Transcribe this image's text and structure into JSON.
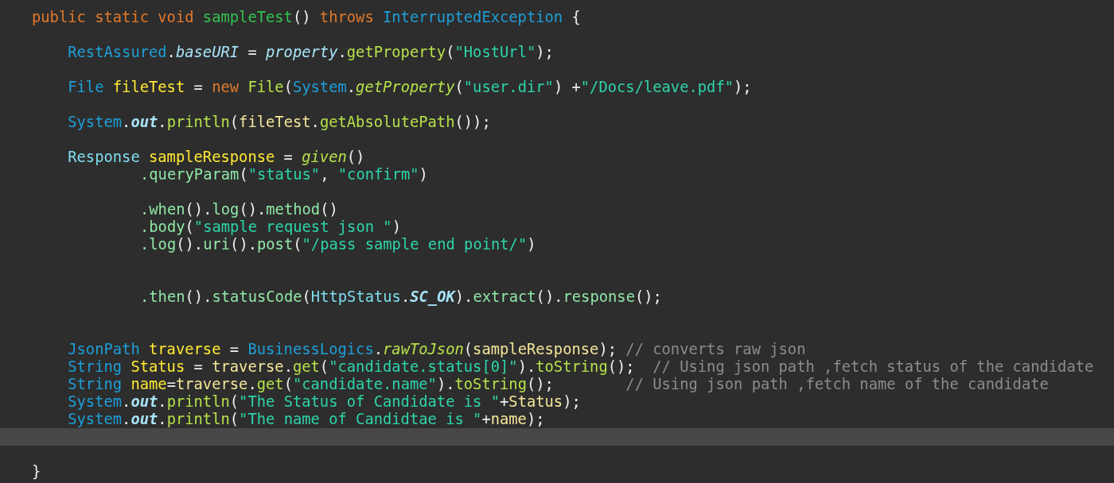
{
  "editor": {
    "lines": [
      {
        "current": false,
        "tokens": [
          {
            "kind": "keyword",
            "text": "public static void "
          },
          {
            "kind": "declaration",
            "text": "sampleTest"
          },
          {
            "kind": "plain",
            "text": "() "
          },
          {
            "kind": "keyword",
            "text": "throws "
          },
          {
            "kind": "type",
            "text": "InterruptedException"
          },
          {
            "kind": "plain",
            "text": " {"
          }
        ]
      },
      {
        "current": false
      },
      {
        "current": false,
        "tokens": [
          {
            "kind": "type",
            "text": "    RestAssured"
          },
          {
            "kind": "plain",
            "text": "."
          },
          {
            "kind": "field",
            "text": "baseURI"
          },
          {
            "kind": "plain",
            "text": " = "
          },
          {
            "kind": "field",
            "text": "property"
          },
          {
            "kind": "plain",
            "text": "."
          },
          {
            "kind": "method",
            "text": "getProperty"
          },
          {
            "kind": "plain",
            "text": "("
          },
          {
            "kind": "string",
            "text": "\"HostUrl\""
          },
          {
            "kind": "plain",
            "text": ");"
          }
        ]
      },
      {
        "current": false
      },
      {
        "current": false,
        "tokens": [
          {
            "kind": "type",
            "text": "    File "
          },
          {
            "kind": "variable",
            "text": "fileTest"
          },
          {
            "kind": "plain",
            "text": " = "
          },
          {
            "kind": "keyword",
            "text": "new "
          },
          {
            "kind": "method",
            "text": "File"
          },
          {
            "kind": "plain",
            "text": "("
          },
          {
            "kind": "type",
            "text": "System"
          },
          {
            "kind": "plain",
            "text": "."
          },
          {
            "kind": "static_method",
            "text": "getProperty"
          },
          {
            "kind": "plain",
            "text": "("
          },
          {
            "kind": "string",
            "text": "\"user.dir\""
          },
          {
            "kind": "plain",
            "text": ") +"
          },
          {
            "kind": "string",
            "text": "\"/Docs/leave.pdf\""
          },
          {
            "kind": "plain",
            "text": ");"
          }
        ]
      },
      {
        "current": false
      },
      {
        "current": false,
        "tokens": [
          {
            "kind": "type",
            "text": "    System"
          },
          {
            "kind": "plain",
            "text": "."
          },
          {
            "kind": "constant",
            "text": "out"
          },
          {
            "kind": "plain",
            "text": "."
          },
          {
            "kind": "method",
            "text": "println"
          },
          {
            "kind": "plain",
            "text": "("
          },
          {
            "kind": "local",
            "text": "fileTest"
          },
          {
            "kind": "plain",
            "text": "."
          },
          {
            "kind": "method",
            "text": "getAbsolutePath"
          },
          {
            "kind": "plain",
            "text": "());"
          }
        ]
      },
      {
        "current": false
      },
      {
        "current": false,
        "tokens": [
          {
            "kind": "class",
            "text": "    Response "
          },
          {
            "kind": "variable",
            "text": "sampleResponse"
          },
          {
            "kind": "plain",
            "text": " = "
          },
          {
            "kind": "static_method",
            "text": "given"
          },
          {
            "kind": "plain",
            "text": "()"
          }
        ]
      },
      {
        "current": false,
        "kind": "continuation",
        "tokens": [
          {
            "kind": "chain",
            "text": ".queryParam"
          },
          {
            "kind": "plain",
            "text": "("
          },
          {
            "kind": "string",
            "text": "\"status\""
          },
          {
            "kind": "plain",
            "text": ", "
          },
          {
            "kind": "string",
            "text": "\"confirm\""
          },
          {
            "kind": "plain",
            "text": ")"
          }
        ]
      },
      {
        "current": false
      },
      {
        "current": false,
        "kind": "continuation",
        "tokens": [
          {
            "kind": "chain",
            "text": ".when"
          },
          {
            "kind": "plain",
            "text": "()."
          },
          {
            "kind": "chain",
            "text": "log"
          },
          {
            "kind": "plain",
            "text": "()."
          },
          {
            "kind": "chain",
            "text": "method"
          },
          {
            "kind": "plain",
            "text": "()"
          }
        ]
      },
      {
        "current": false,
        "kind": "continuation",
        "tokens": [
          {
            "kind": "chain",
            "text": ".body"
          },
          {
            "kind": "plain",
            "text": "("
          },
          {
            "kind": "string",
            "text": "\"sample request json \""
          },
          {
            "kind": "plain",
            "text": ")"
          }
        ]
      },
      {
        "current": false,
        "kind": "continuation",
        "tokens": [
          {
            "kind": "chain",
            "text": ".log"
          },
          {
            "kind": "plain",
            "text": "()."
          },
          {
            "kind": "chain",
            "text": "uri"
          },
          {
            "kind": "plain",
            "text": "()."
          },
          {
            "kind": "chain",
            "text": "post"
          },
          {
            "kind": "plain",
            "text": "("
          },
          {
            "kind": "string",
            "text": "\"/pass sample end point/\""
          },
          {
            "kind": "plain",
            "text": ")"
          }
        ]
      },
      {
        "current": false
      },
      {
        "current": false
      },
      {
        "current": false,
        "kind": "continuation",
        "tokens": [
          {
            "kind": "chain",
            "text": ".then"
          },
          {
            "kind": "plain",
            "text": "()."
          },
          {
            "kind": "chain",
            "text": "statusCode"
          },
          {
            "kind": "plain",
            "text": "("
          },
          {
            "kind": "class",
            "text": "HttpStatus"
          },
          {
            "kind": "plain",
            "text": "."
          },
          {
            "kind": "constant",
            "text": "SC_OK"
          },
          {
            "kind": "plain",
            "text": ")."
          },
          {
            "kind": "chain",
            "text": "extract"
          },
          {
            "kind": "plain",
            "text": "()."
          },
          {
            "kind": "chain",
            "text": "response"
          },
          {
            "kind": "plain",
            "text": "();"
          }
        ]
      },
      {
        "current": false
      },
      {
        "current": false
      },
      {
        "current": false,
        "tokens": [
          {
            "kind": "type",
            "text": "    JsonPath "
          },
          {
            "kind": "variable",
            "text": "traverse"
          },
          {
            "kind": "plain",
            "text": " = "
          },
          {
            "kind": "type",
            "text": "BusinessLogics"
          },
          {
            "kind": "plain",
            "text": "."
          },
          {
            "kind": "static_method",
            "text": "rawToJson"
          },
          {
            "kind": "plain",
            "text": "("
          },
          {
            "kind": "local",
            "text": "sampleResponse"
          },
          {
            "kind": "plain",
            "text": "); "
          },
          {
            "kind": "comment",
            "text": "// converts raw json"
          }
        ]
      },
      {
        "current": false,
        "tokens": [
          {
            "kind": "type",
            "text": "    String "
          },
          {
            "kind": "variable",
            "text": "Status"
          },
          {
            "kind": "plain",
            "text": " = "
          },
          {
            "kind": "local",
            "text": "traverse"
          },
          {
            "kind": "plain",
            "text": "."
          },
          {
            "kind": "method",
            "text": "get"
          },
          {
            "kind": "plain",
            "text": "("
          },
          {
            "kind": "string",
            "text": "\"candidate.status[0]\""
          },
          {
            "kind": "plain",
            "text": ")."
          },
          {
            "kind": "method",
            "text": "toString"
          },
          {
            "kind": "plain",
            "text": "();  "
          },
          {
            "kind": "comment",
            "text": "// Using json path ,fetch status of the candidate"
          }
        ]
      },
      {
        "current": false,
        "tokens": [
          {
            "kind": "type",
            "text": "    String "
          },
          {
            "kind": "variable",
            "text": "name"
          },
          {
            "kind": "plain",
            "text": "="
          },
          {
            "kind": "local",
            "text": "traverse"
          },
          {
            "kind": "plain",
            "text": "."
          },
          {
            "kind": "method",
            "text": "get"
          },
          {
            "kind": "plain",
            "text": "("
          },
          {
            "kind": "string",
            "text": "\"candidate.name\""
          },
          {
            "kind": "plain",
            "text": ")."
          },
          {
            "kind": "method",
            "text": "toString"
          },
          {
            "kind": "plain",
            "text": "();        "
          },
          {
            "kind": "comment",
            "text": "// Using json path ,fetch name of the candidate"
          }
        ]
      },
      {
        "current": false,
        "tokens": [
          {
            "kind": "type",
            "text": "    System"
          },
          {
            "kind": "plain",
            "text": "."
          },
          {
            "kind": "constant",
            "text": "out"
          },
          {
            "kind": "plain",
            "text": "."
          },
          {
            "kind": "method",
            "text": "println"
          },
          {
            "kind": "plain",
            "text": "("
          },
          {
            "kind": "string",
            "text": "\"The Status of Candidate is \""
          },
          {
            "kind": "plain",
            "text": "+"
          },
          {
            "kind": "local",
            "text": "Status"
          },
          {
            "kind": "plain",
            "text": ");"
          }
        ]
      },
      {
        "current": false,
        "tokens": [
          {
            "kind": "type",
            "text": "    System"
          },
          {
            "kind": "plain",
            "text": "."
          },
          {
            "kind": "constant",
            "text": "out"
          },
          {
            "kind": "plain",
            "text": "."
          },
          {
            "kind": "method",
            "text": "println"
          },
          {
            "kind": "plain",
            "text": "("
          },
          {
            "kind": "string",
            "text": "\"The name of Candidtae is \""
          },
          {
            "kind": "plain",
            "text": "+"
          },
          {
            "kind": "local",
            "text": "name"
          },
          {
            "kind": "plain",
            "text": ");"
          }
        ]
      },
      {
        "current": true
      },
      {
        "current": false
      },
      {
        "current": false,
        "tokens": [
          {
            "kind": "plain",
            "text": "}"
          }
        ]
      }
    ]
  }
}
